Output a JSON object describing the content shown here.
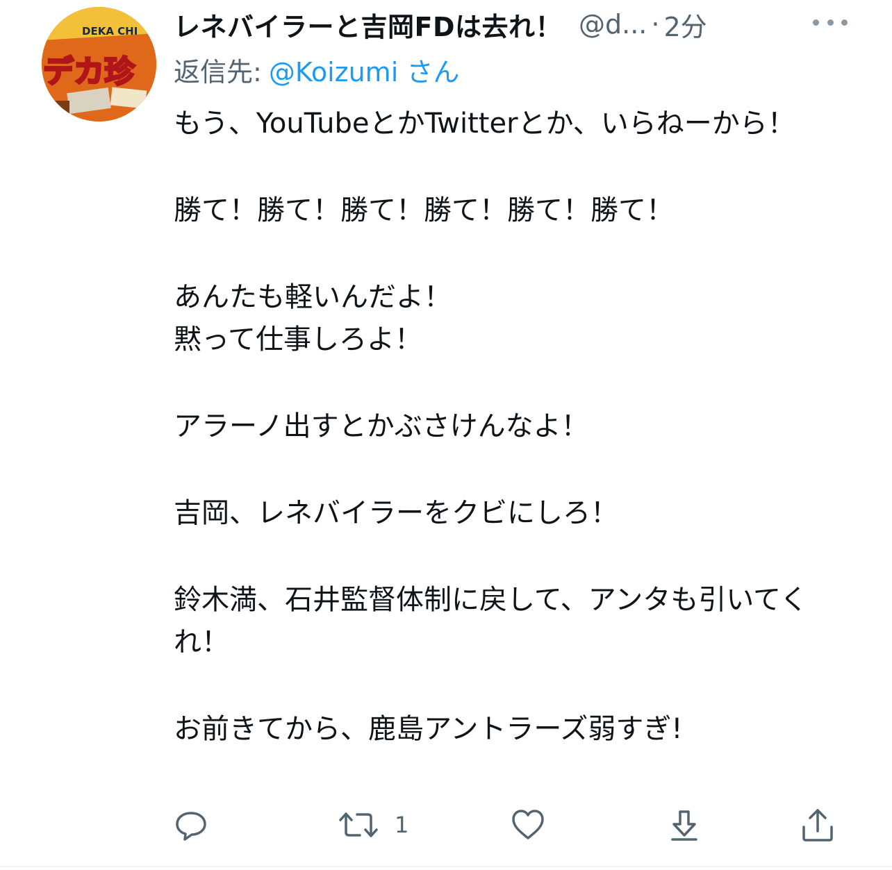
{
  "tweet": {
    "display_name": "レネバイラーと吉岡FDは去れ！",
    "handle": "@d...",
    "separator": "·",
    "time": "2分",
    "reply_prefix": "返信先:",
    "reply_mention": "@Koizumi",
    "reply_suffix": "さん",
    "avatar_text": "DEKA CHI",
    "avatar_big": "デカ珍",
    "paragraphs": [
      "もう、YouTubeとかTwitterとか、いらねーから！",
      "勝て！勝て！勝て！勝て！勝て！勝て！",
      "あんたも軽いんだよ！",
      "黙って仕事しろよ！",
      "アラーノ出すとかぶさけんなよ！",
      "吉岡、レネバイラーをクビにしろ！",
      "鈴木満、石井監督体制に戻して、アンタも引いてくれ！",
      "お前きてから、鹿島アントラーズ弱すぎ!"
    ],
    "retweet_count": "1"
  },
  "icons": {
    "more": "more-horizontal-icon",
    "reply": "reply-bubble-icon",
    "retweet": "retweet-icon",
    "like": "heart-icon",
    "download": "download-arrow-icon",
    "share": "share-upload-icon"
  },
  "colors": {
    "text": "#0f1419",
    "secondary": "#536471",
    "link": "#1d9bf0",
    "icon": "#536471"
  }
}
